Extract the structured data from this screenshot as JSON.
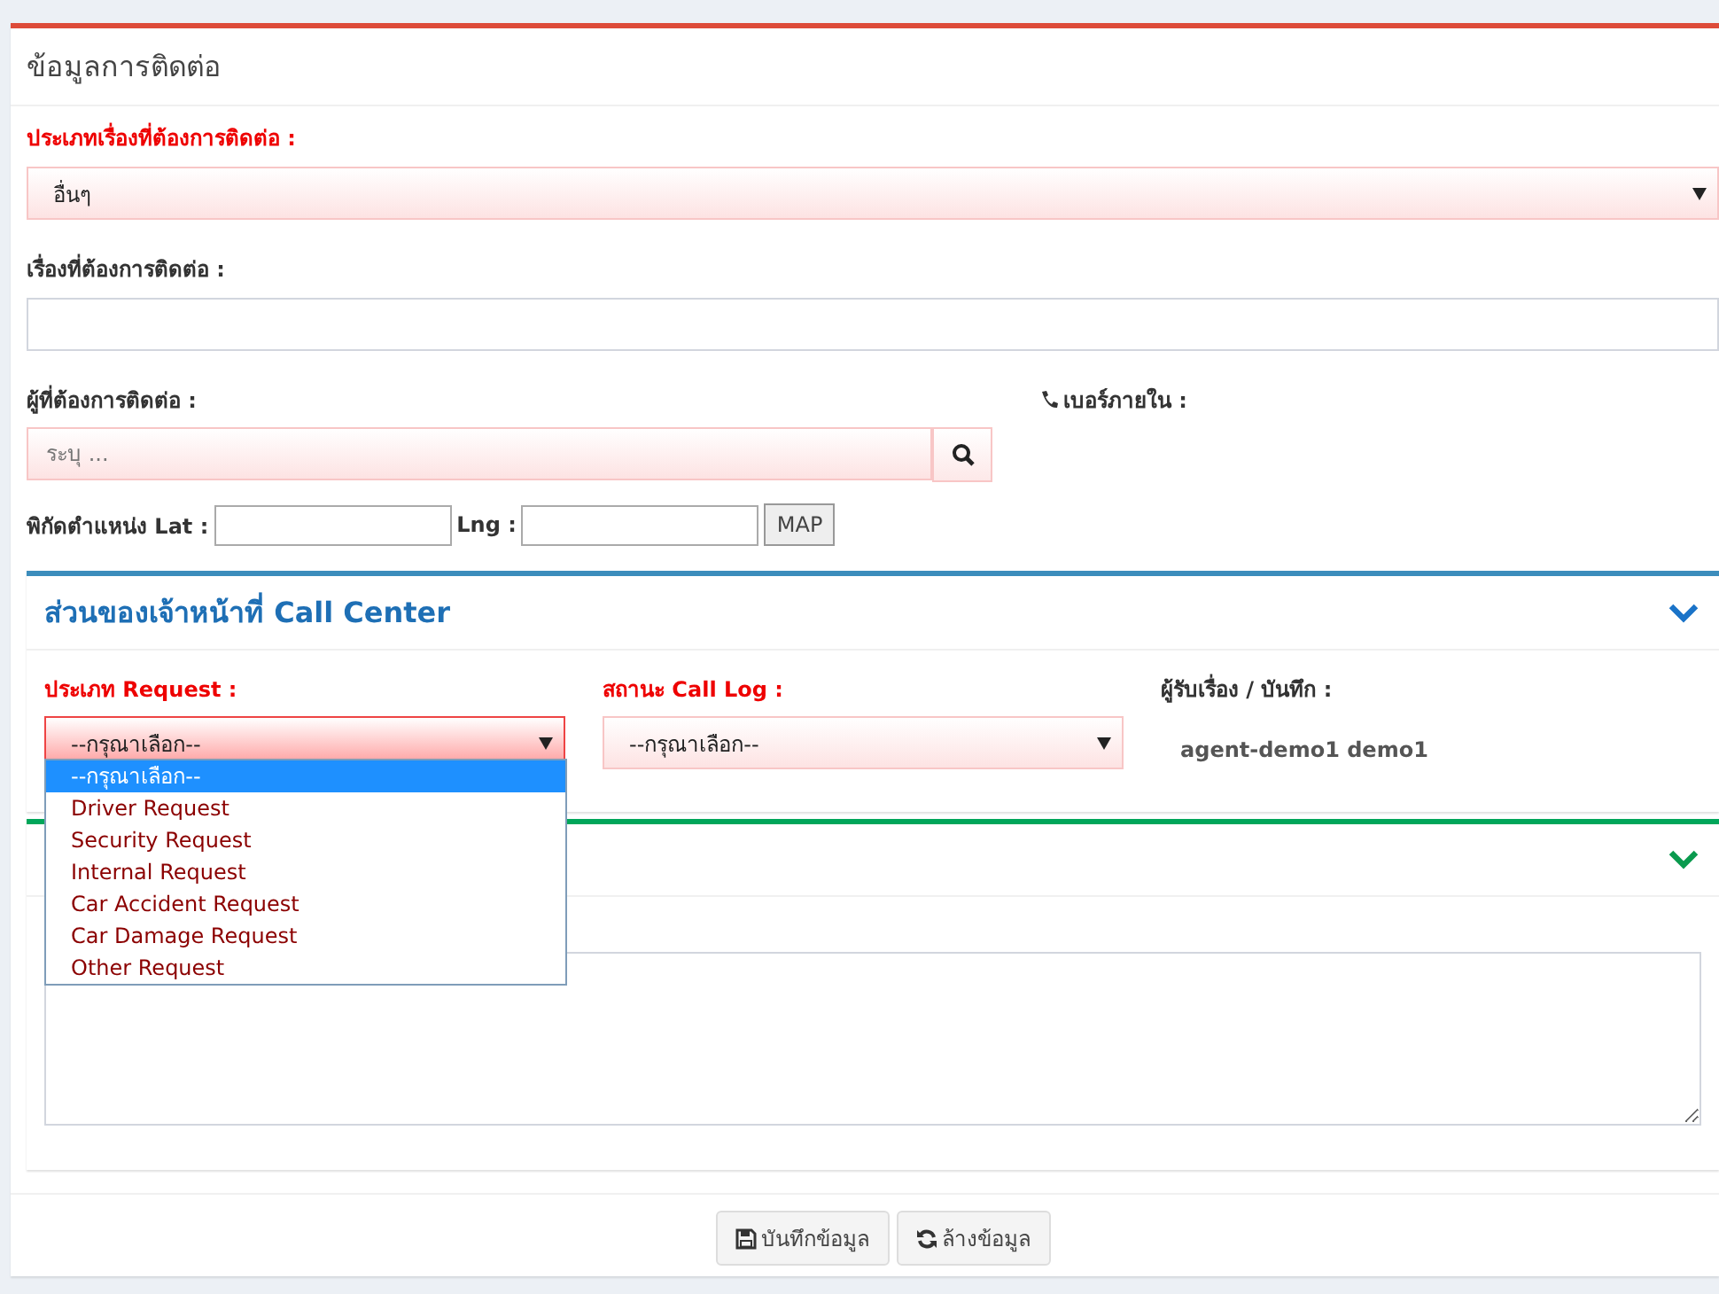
{
  "panel": {
    "title": "ข้อมูลการติดต่อ"
  },
  "contact_type": {
    "label": "ประเภทเรื่องที่ต้องการติดต่อ :",
    "required": true,
    "value": "อื่นๆ"
  },
  "subject": {
    "label": "เรื่องที่ต้องการติดต่อ :",
    "required": false
  },
  "contact_person": {
    "label": "ผู้ที่ต้องการติดต่อ :",
    "required": false,
    "placeholder": "ระบุ ..."
  },
  "extension": {
    "label": "เบอร์ภายใน :"
  },
  "coordinates": {
    "lat_label": "พิกัดตำแหน่ง Lat :",
    "lng_label": "Lng :",
    "map_button": "MAP"
  },
  "call_center": {
    "title": "ส่วนของเจ้าหน้าที่ Call Center",
    "expanded": true,
    "request_type": {
      "label": "ประเภท Request :",
      "required": true,
      "value": "--กรุณาเลือก--",
      "open": true,
      "options": [
        {
          "label": "--กรุณาเลือก--",
          "selected": true
        },
        {
          "label": "Driver Request",
          "selected": false
        },
        {
          "label": "Security Request",
          "selected": false
        },
        {
          "label": "Internal Request",
          "selected": false
        },
        {
          "label": "Car Accident Request",
          "selected": false
        },
        {
          "label": "Car Damage Request",
          "selected": false
        },
        {
          "label": "Other Request",
          "selected": false
        }
      ]
    },
    "call_log_status": {
      "label": "สถานะ Call Log :",
      "required": true,
      "value": "--กรุณาเลือก--"
    },
    "receiver": {
      "label": "ผู้รับเรื่อง / บันทึก :",
      "value": "agent-demo1 demo1"
    }
  },
  "details_section": {
    "expanded": true
  },
  "buttons": [
    {
      "label": "บันทึกข้อมูล",
      "kind": "save"
    },
    {
      "label": "ล้างข้อมูล",
      "kind": "reset"
    }
  ]
}
